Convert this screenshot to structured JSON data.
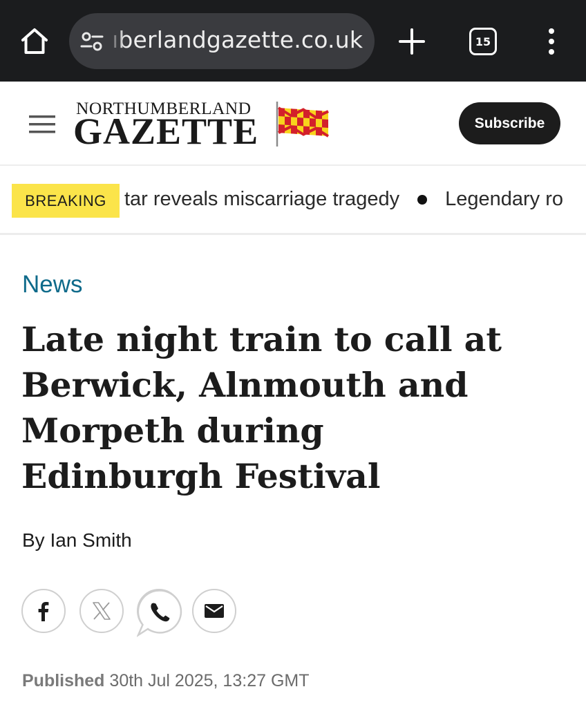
{
  "browser": {
    "url_text": "ıberlandgazette.co.uk",
    "tab_count": "15",
    "icons": [
      "home-icon",
      "site-settings-icon",
      "plus-icon",
      "tabs-icon",
      "more-vert-icon"
    ]
  },
  "site": {
    "logo_top": "NORTHUMBERLAND",
    "logo_main": "GAZETTE",
    "subscribe_label": "Subscribe",
    "colors": {
      "flag_red": "#d3202b",
      "flag_yellow": "#f8d41c",
      "section": "#0e6a8a",
      "badge": "#fbe44a"
    }
  },
  "ticker": {
    "badge": "BREAKING",
    "items": [
      "tar reveals miscarriage tragedy",
      "Legendary ro"
    ]
  },
  "article": {
    "section": "News",
    "headline": "Late night train to call at Berwick, Alnmouth and Morpeth during Edinburgh Festival",
    "byline": "By Ian Smith",
    "share": [
      "facebook-icon",
      "x-icon",
      "whatsapp-icon",
      "email-icon"
    ],
    "published_label": "Published",
    "published_date": "30th Jul 2025, 13:27 GMT"
  }
}
